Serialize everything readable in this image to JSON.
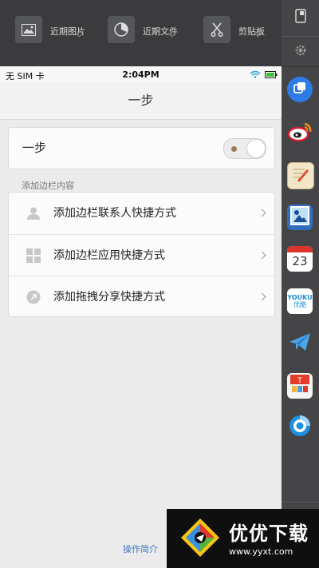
{
  "toolbar": {
    "recent_images": "近期图片",
    "recent_files": "近期文件",
    "clipboard": "剪贴板"
  },
  "status_bar": {
    "carrier": "无 SIM 卡",
    "time": "2:04PM"
  },
  "screen": {
    "title": "一步",
    "toggle_label": "一步",
    "toggle_on": true,
    "section_label": "添加边栏内容",
    "items": [
      {
        "label": "添加边栏联系人快捷方式",
        "icon": "person-icon"
      },
      {
        "label": "添加边栏应用快捷方式",
        "icon": "grid-icon"
      },
      {
        "label": "添加拖拽分享快捷方式",
        "icon": "share-icon"
      }
    ],
    "footer_link": "操作简介"
  },
  "sidebar": {
    "apps": [
      {
        "icon": "one-step-icon"
      },
      {
        "icon": "weibo-icon"
      },
      {
        "icon": "notes-icon"
      },
      {
        "icon": "photos-icon"
      },
      {
        "icon": "calendar-icon",
        "text": "23"
      },
      {
        "icon": "youku-icon",
        "text": "YOUKU",
        "subtext": "优酷"
      },
      {
        "icon": "mail-icon"
      },
      {
        "icon": "store-icon"
      },
      {
        "icon": "browser-icon"
      }
    ]
  },
  "watermark": {
    "name": "优优下载",
    "url": "www.yyxt.com"
  }
}
